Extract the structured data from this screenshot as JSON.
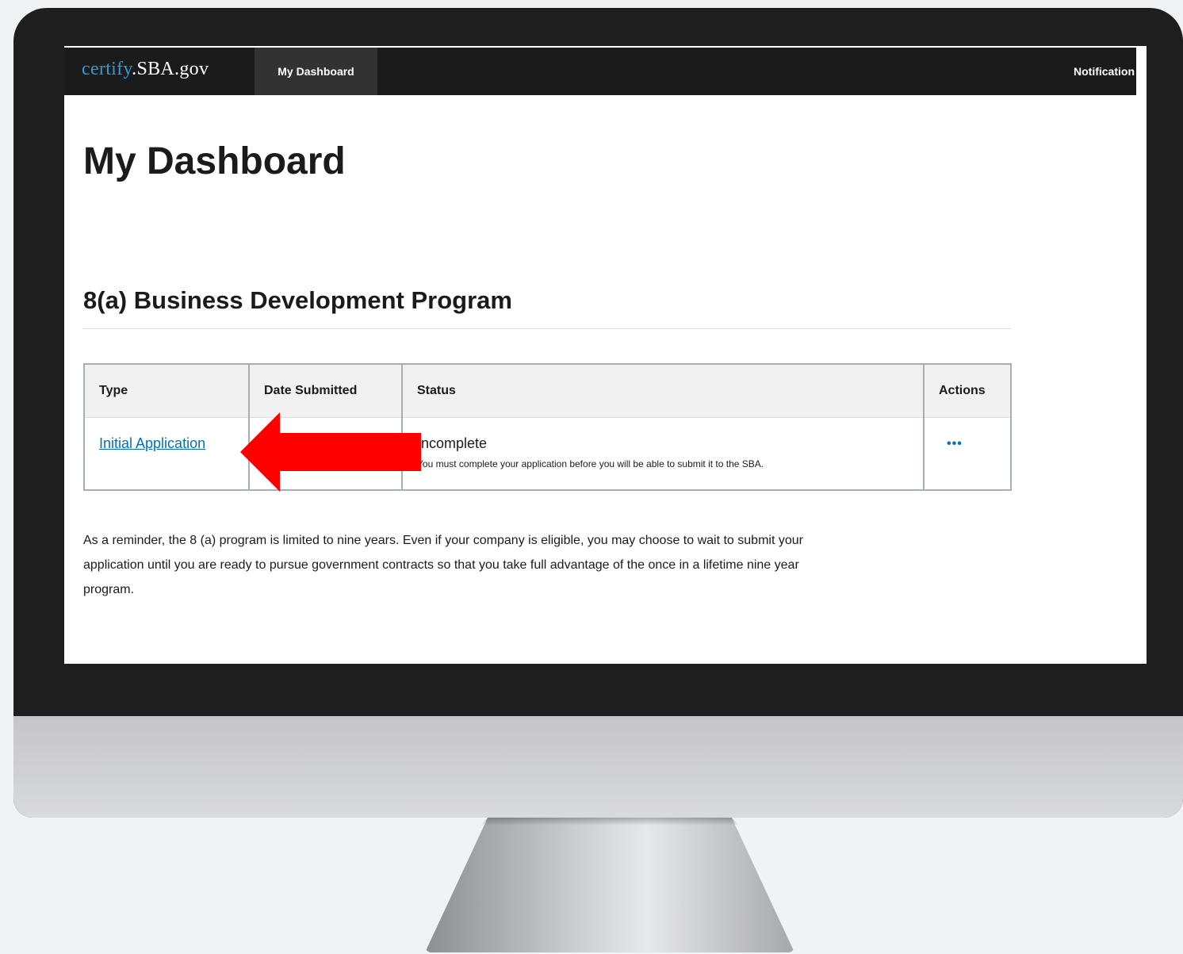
{
  "navbar": {
    "brand_part1": "certify",
    "brand_part2": ".SBA.gov",
    "tab_dashboard": "My Dashboard",
    "notifications": "Notification"
  },
  "page": {
    "title": "My Dashboard",
    "section_title": "8(a) Business Development Program"
  },
  "table": {
    "headers": [
      "Type",
      "Date Submitted",
      "Status",
      "Actions"
    ],
    "rows": [
      {
        "type": "Initial Application",
        "date_submitted": "",
        "status": "Incomplete",
        "status_note": "You must complete your application before you will be able to submit it to the SBA.",
        "actions": "•••"
      }
    ]
  },
  "reminder": "As a reminder, the 8 (a) program is limited to nine years. Even if your company is eligible, you may choose to wait to submit your application until you are ready to pursue government contracts so that you take full advantage of the once in a lifetime nine year program.",
  "colors": {
    "navbar_bg": "#1b1b1b",
    "brand_blue": "#2f9bd6",
    "link_blue": "#0071bc",
    "arrow_red": "#ff0000"
  },
  "icons": {
    "annotation_arrow": "arrow-left-icon",
    "actions": "more-horizontal-icon"
  }
}
